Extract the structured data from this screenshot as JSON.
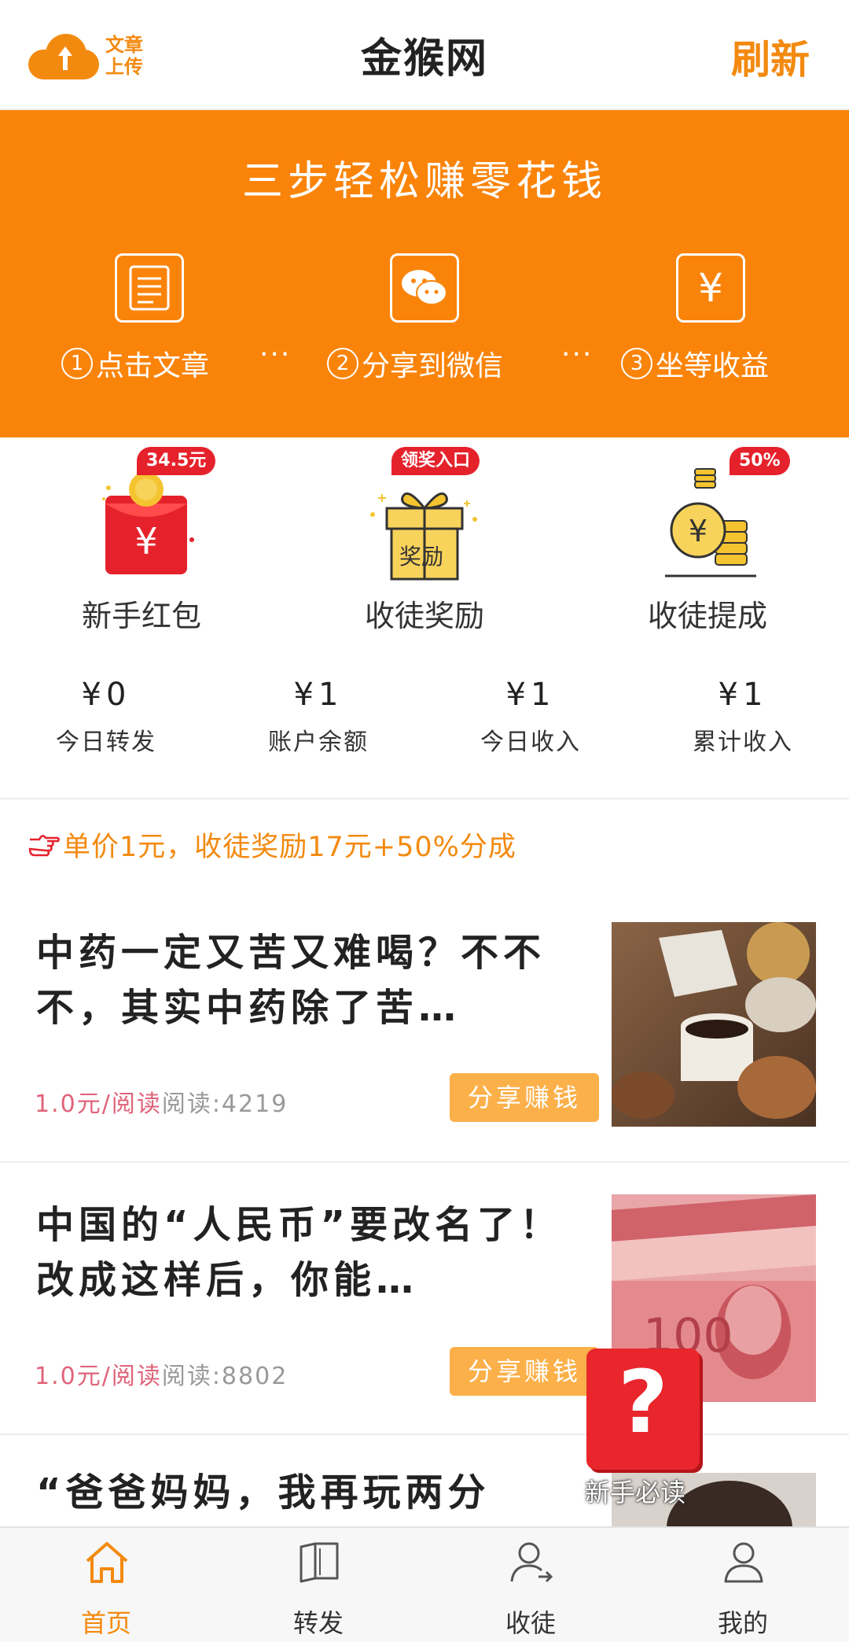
{
  "header": {
    "upload_label": "文章上传",
    "title": "金猴网",
    "refresh_label": "刷新"
  },
  "banner": {
    "title": "三步轻松赚零花钱",
    "steps": [
      {
        "num": "1",
        "label": "点击文章",
        "icon": "article-list-icon"
      },
      {
        "num": "2",
        "label": "分享到微信",
        "icon": "wechat-icon"
      },
      {
        "num": "3",
        "label": "坐等收益",
        "icon": "yuan-icon"
      }
    ],
    "separator": "···"
  },
  "features": [
    {
      "label": "新手红包",
      "badge": "34.5元",
      "icon": "red-envelope-icon"
    },
    {
      "label": "收徒奖励",
      "badge": "领奖入口",
      "icon": "gift-box-icon",
      "icon_text": "奖励"
    },
    {
      "label": "收徒提成",
      "badge": "50%",
      "icon": "coin-stack-icon"
    }
  ],
  "stats": [
    {
      "value": "¥0",
      "label": "今日转发"
    },
    {
      "value": "¥1",
      "label": "账户余额"
    },
    {
      "value": "¥1",
      "label": "今日收入"
    },
    {
      "value": "¥1",
      "label": "累计收入"
    }
  ],
  "promo": "单价1元，收徒奖励17元+50%分成",
  "articles": [
    {
      "title": "中药一定又苦又难喝？不不不，其实中药除了苦…",
      "price": "1.0元/阅读",
      "reads": "阅读:4219",
      "share_label": "分享赚钱"
    },
    {
      "title": "中国的“人民币”要改名了！改成这样后，你能…",
      "price": "1.0元/阅读",
      "reads": "阅读:8802",
      "share_label": "分享赚钱"
    },
    {
      "title": "“爸爸妈妈，我再玩两分",
      "price": "",
      "reads": "",
      "share_label": ""
    }
  ],
  "help": {
    "symbol": "?",
    "label": "新手必读"
  },
  "nav": [
    {
      "label": "首页",
      "icon": "home-icon",
      "active": true
    },
    {
      "label": "转发",
      "icon": "book-icon",
      "active": false
    },
    {
      "label": "收徒",
      "icon": "user-share-icon",
      "active": false
    },
    {
      "label": "我的",
      "icon": "profile-icon",
      "active": false
    }
  ],
  "colors": {
    "brand": "#fa840a",
    "badge": "#e5222c",
    "share_button": "#fbb04a",
    "price": "#e0637a"
  }
}
